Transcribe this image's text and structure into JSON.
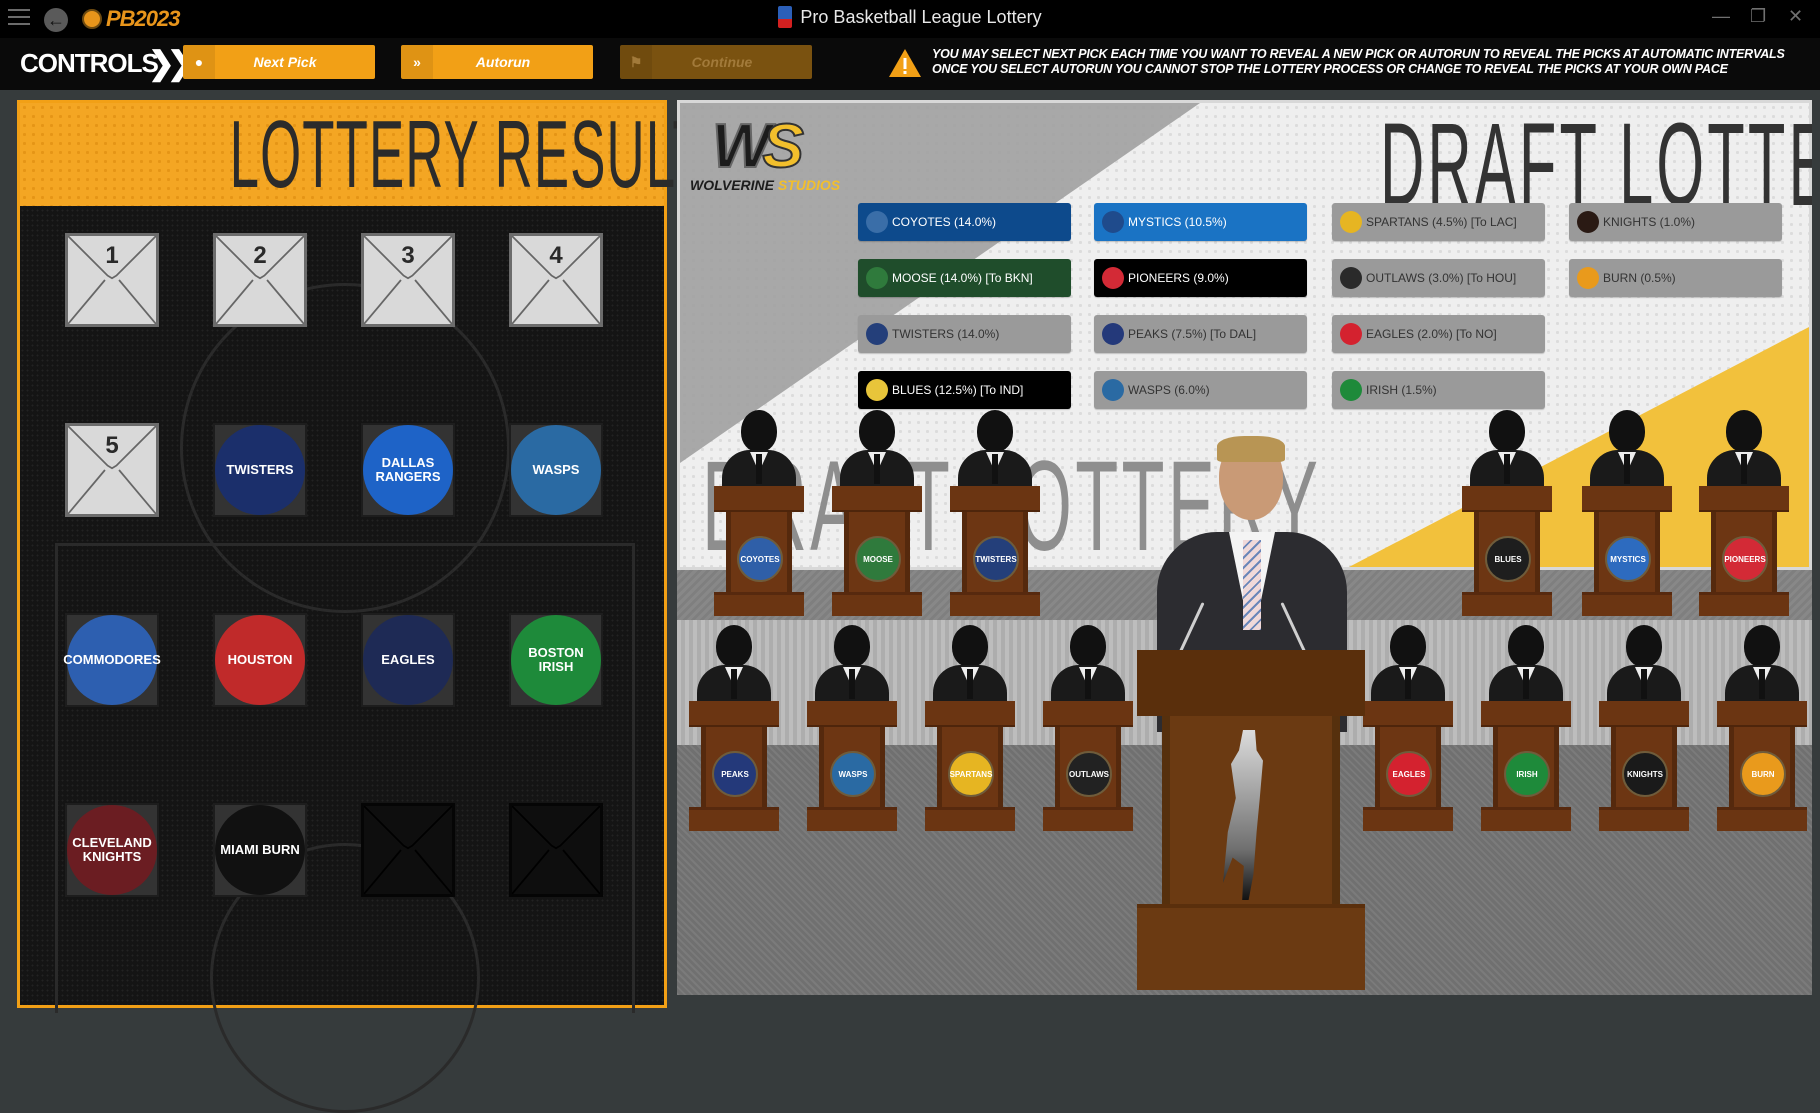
{
  "window": {
    "title": "Pro Basketball League Lottery",
    "app_logo_text": "PB2023",
    "controls": {
      "minimize": "—",
      "restore": "❐",
      "close": "✕"
    }
  },
  "controls_bar": {
    "label": "CONTROLS",
    "buttons": [
      {
        "label": "Next Pick",
        "icon": "play-circle-icon",
        "glyph": "●",
        "enabled": true
      },
      {
        "label": "Autorun",
        "icon": "double-chevron-icon",
        "glyph": "»",
        "enabled": true
      },
      {
        "label": "Continue",
        "icon": "checkered-flag-icon",
        "glyph": "⚑",
        "enabled": false
      }
    ],
    "warning_lines": [
      "YOU MAY SELECT NEXT PICK EACH TIME YOU WANT TO REVEAL A NEW PICK OR AUTORUN TO REVEAL THE PICKS AT AUTOMATIC INTERVALS",
      "ONCE YOU SELECT AUTORUN YOU CANNOT STOP THE LOTTERY PROCESS OR CHANGE TO REVEAL THE PICKS AT YOUR OWN PACE"
    ]
  },
  "lottery_results": {
    "title": "LOTTERY RESULTS",
    "slots": [
      {
        "type": "envelope",
        "number": "1"
      },
      {
        "type": "envelope",
        "number": "2"
      },
      {
        "type": "envelope",
        "number": "3"
      },
      {
        "type": "envelope",
        "number": "4"
      },
      {
        "type": "envelope",
        "number": "5"
      },
      {
        "type": "team",
        "name": "TWISTERS",
        "color": "#1b2f6b"
      },
      {
        "type": "team",
        "name": "DALLAS RANGERS",
        "color": "#1e63c7"
      },
      {
        "type": "team",
        "name": "WASPS",
        "color": "#2a6aa3"
      },
      {
        "type": "team",
        "name": "COMMODORES",
        "color": "#2d5fb0"
      },
      {
        "type": "team",
        "name": "HOUSTON",
        "color": "#c02a2a"
      },
      {
        "type": "team",
        "name": "EAGLES",
        "color": "#1e2a55"
      },
      {
        "type": "team",
        "name": "BOSTON IRISH",
        "color": "#1e8a3a"
      },
      {
        "type": "team",
        "name": "CLEVELAND KNIGHTS",
        "color": "#6b1d22"
      },
      {
        "type": "team",
        "name": "MIAMI BURN",
        "color": "#111111"
      },
      {
        "type": "empty"
      },
      {
        "type": "empty"
      }
    ]
  },
  "stage": {
    "brand_name": "WOLVERINE",
    "brand_suffix": "STUDIOS",
    "brand_initials_w": "W",
    "brand_initials_s": "S",
    "title": "DRAFT LOTTERY",
    "bg_word": "DRAFT LOTTERY",
    "odds": [
      {
        "label": "COYOTES (14.0%)",
        "state": "active",
        "bg": "#0d4a8c",
        "logo": "#3a6ea8"
      },
      {
        "label": "MOOSE (14.0%)  [To BKN]",
        "state": "active",
        "bg": "#1f4d2b",
        "logo": "#2f7a3c"
      },
      {
        "label": "TWISTERS (14.0%)",
        "state": "inactive",
        "bg": "#9a9a9a",
        "logo": "#243f7a"
      },
      {
        "label": "BLUES (12.5%)  [To IND]",
        "state": "active",
        "bg": "#000000",
        "logo": "#e8c53a"
      },
      {
        "label": "MYSTICS (10.5%)",
        "state": "active",
        "bg": "#1a73c4",
        "logo": "#1f4b8c"
      },
      {
        "label": "PIONEERS (9.0%)",
        "state": "active",
        "bg": "#000000",
        "logo": "#d32a36"
      },
      {
        "label": "PEAKS (7.5%) [To DAL]",
        "state": "inactive",
        "bg": "#9a9a9a",
        "logo": "#24397a"
      },
      {
        "label": "WASPS (6.0%)",
        "state": "inactive",
        "bg": "#9a9a9a",
        "logo": "#2a6aa3"
      },
      {
        "label": "SPARTANS (4.5%) [To LAC]",
        "state": "inactive",
        "bg": "#9a9a9a",
        "logo": "#e6b522"
      },
      {
        "label": "OUTLAWS (3.0%) [To HOU]",
        "state": "inactive",
        "bg": "#9a9a9a",
        "logo": "#2a2a2a"
      },
      {
        "label": "EAGLES (2.0%) [To NO]",
        "state": "inactive",
        "bg": "#9a9a9a",
        "logo": "#d4222f"
      },
      {
        "label": "IRISH (1.5%)",
        "state": "inactive",
        "bg": "#9a9a9a",
        "logo": "#1e8a3a"
      },
      {
        "label": "KNIGHTS (1.0%)",
        "state": "inactive",
        "bg": "#9a9a9a",
        "logo": "#2a1a14"
      },
      {
        "label": "BURN (0.5%)",
        "state": "inactive",
        "bg": "#9a9a9a",
        "logo": "#e99a1c"
      }
    ],
    "back_row_podiums": [
      {
        "team": "COYOTES",
        "color": "#2f5fa8"
      },
      {
        "team": "MOOSE",
        "color": "#2f7a3c"
      },
      {
        "team": "TWISTERS",
        "color": "#243f7a"
      },
      {
        "team": "BLUES",
        "color": "#1e1e1e"
      },
      {
        "team": "MYSTICS",
        "color": "#2d6bbf"
      },
      {
        "team": "PIONEERS",
        "color": "#d32a36"
      }
    ],
    "front_row_podiums": [
      {
        "team": "PEAKS",
        "color": "#24397a"
      },
      {
        "team": "WASPS",
        "color": "#2a6aa3"
      },
      {
        "team": "SPARTANS",
        "color": "#e6b522"
      },
      {
        "team": "OUTLAWS",
        "color": "#222222"
      },
      {
        "team": "EAGLES",
        "color": "#d4222f"
      },
      {
        "team": "IRISH",
        "color": "#1e8a3a"
      },
      {
        "team": "KNIGHTS",
        "color": "#1a1a1a"
      },
      {
        "team": "BURN",
        "color": "#e99a1c"
      }
    ]
  },
  "colors": {
    "accent": "#f2a016",
    "panel_bg": "#141414",
    "app_bg": "#363b3c"
  }
}
